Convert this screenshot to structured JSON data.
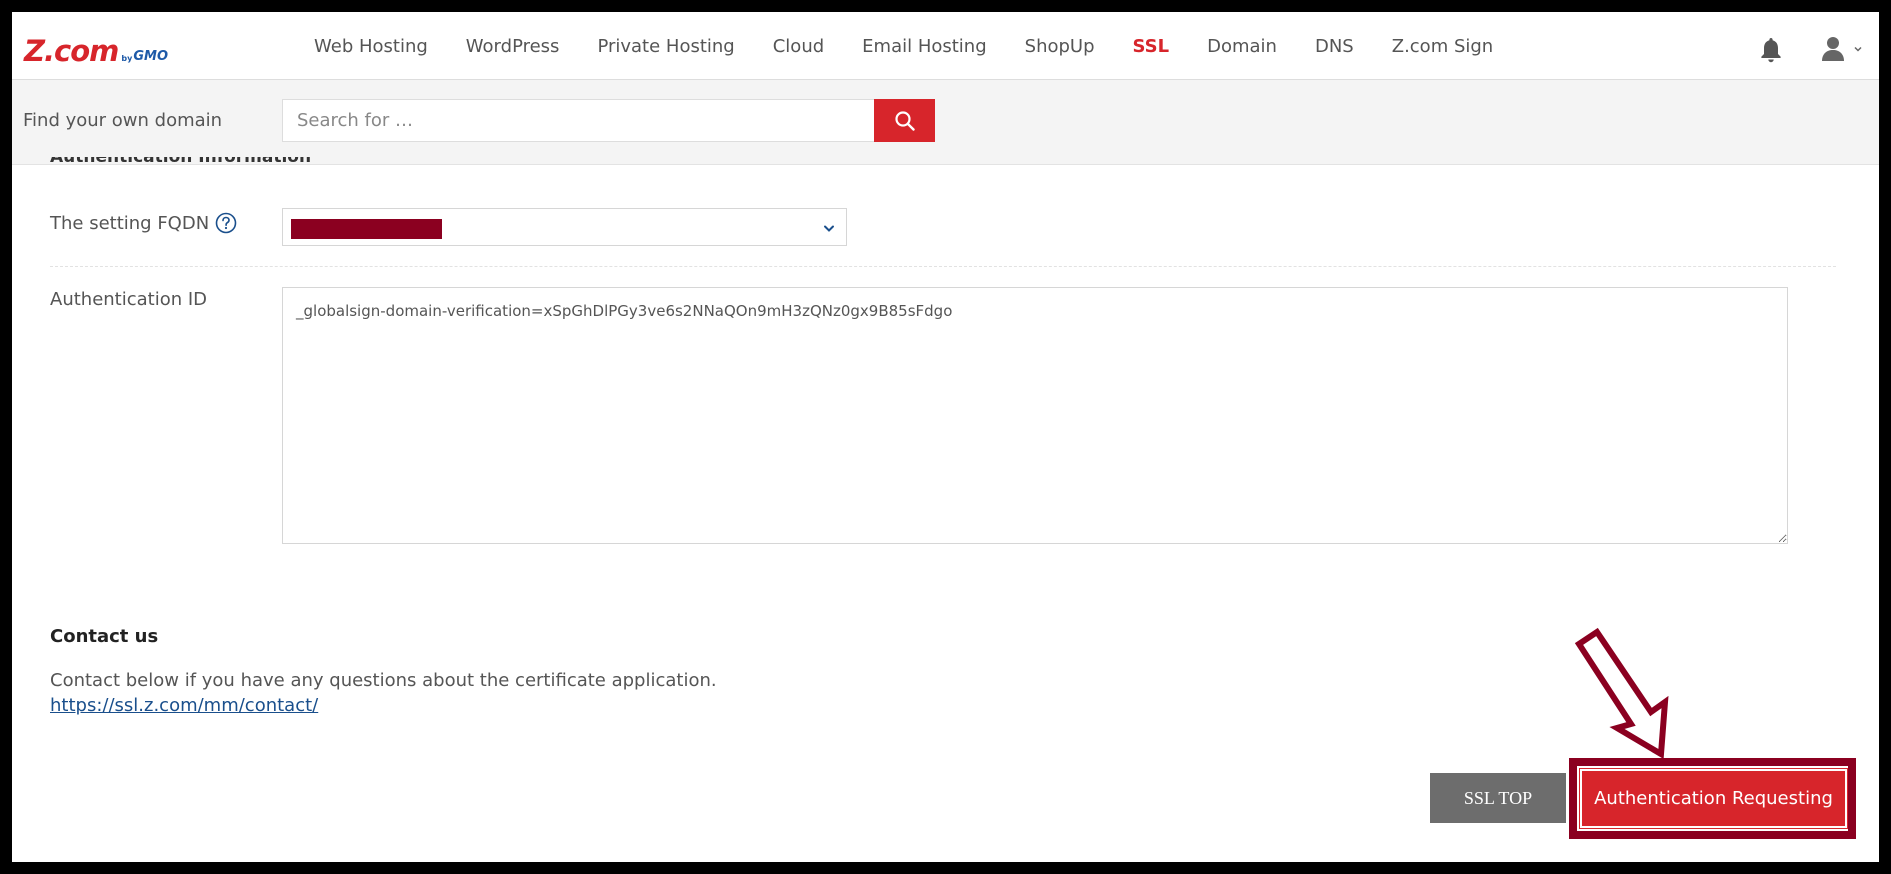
{
  "header": {
    "logo": {
      "main": "Z.com",
      "by": "by",
      "gmo": "GMO"
    },
    "nav": [
      {
        "label": "Web Hosting",
        "active": false
      },
      {
        "label": "WordPress",
        "active": false
      },
      {
        "label": "Private Hosting",
        "active": false
      },
      {
        "label": "Cloud",
        "active": false
      },
      {
        "label": "Email Hosting",
        "active": false
      },
      {
        "label": "ShopUp",
        "active": false
      },
      {
        "label": "SSL",
        "active": true
      },
      {
        "label": "Domain",
        "active": false
      },
      {
        "label": "DNS",
        "active": false
      },
      {
        "label": "Z.com Sign",
        "active": false
      }
    ],
    "icons": {
      "bell": "bell-icon",
      "user": "user-icon",
      "user_menu": "chevron-down-icon"
    }
  },
  "search": {
    "label": "Find your own domain",
    "placeholder": "Search for …",
    "button_icon": "search-icon"
  },
  "form": {
    "section_title": "Authentication Information",
    "fqdn_label": "The setting FQDN",
    "fqdn_help_icon": "question-circle-icon",
    "fqdn_value": "",
    "authid_label": "Authentication ID",
    "authid_value": "_globalsign-domain-verification=xSpGhDlPGy3ve6s2NNaQOn9mH3zQNz0gx9B85sFdgo"
  },
  "contact": {
    "title": "Contact us",
    "text": "Contact below if you have any questions about the certificate application.",
    "link": "https://ssl.z.com/mm/contact/"
  },
  "actions": {
    "ssl_top": "SSL TOP",
    "auth_request": "Authentication Requesting"
  },
  "colors": {
    "brand_red": "#d7252b",
    "highlight": "#8b0020",
    "link_blue": "#1a4f8c",
    "gray_button": "#6d6d6d"
  }
}
